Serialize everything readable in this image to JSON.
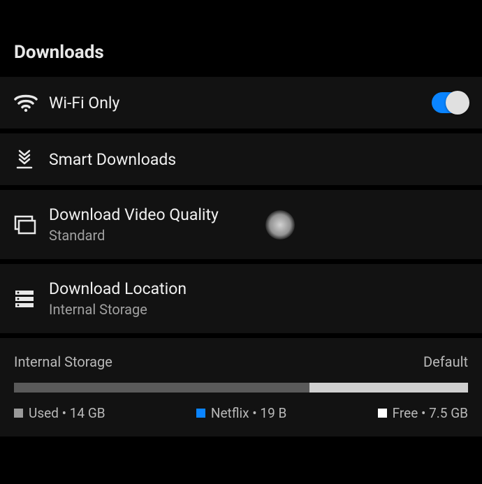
{
  "section_title": "Downloads",
  "rows": {
    "wifi": {
      "label": "Wi-Fi Only",
      "toggle_on": true
    },
    "smart": {
      "label": "Smart Downloads"
    },
    "quality": {
      "label": "Download Video Quality",
      "sublabel": "Standard"
    },
    "location": {
      "label": "Download Location",
      "sublabel": "Internal Storage"
    }
  },
  "storage": {
    "name": "Internal Storage",
    "status": "Default",
    "legend": {
      "used": "Used • 14 GB",
      "netflix": "Netflix • 19 B",
      "free": "Free • 7.5 GB"
    }
  }
}
